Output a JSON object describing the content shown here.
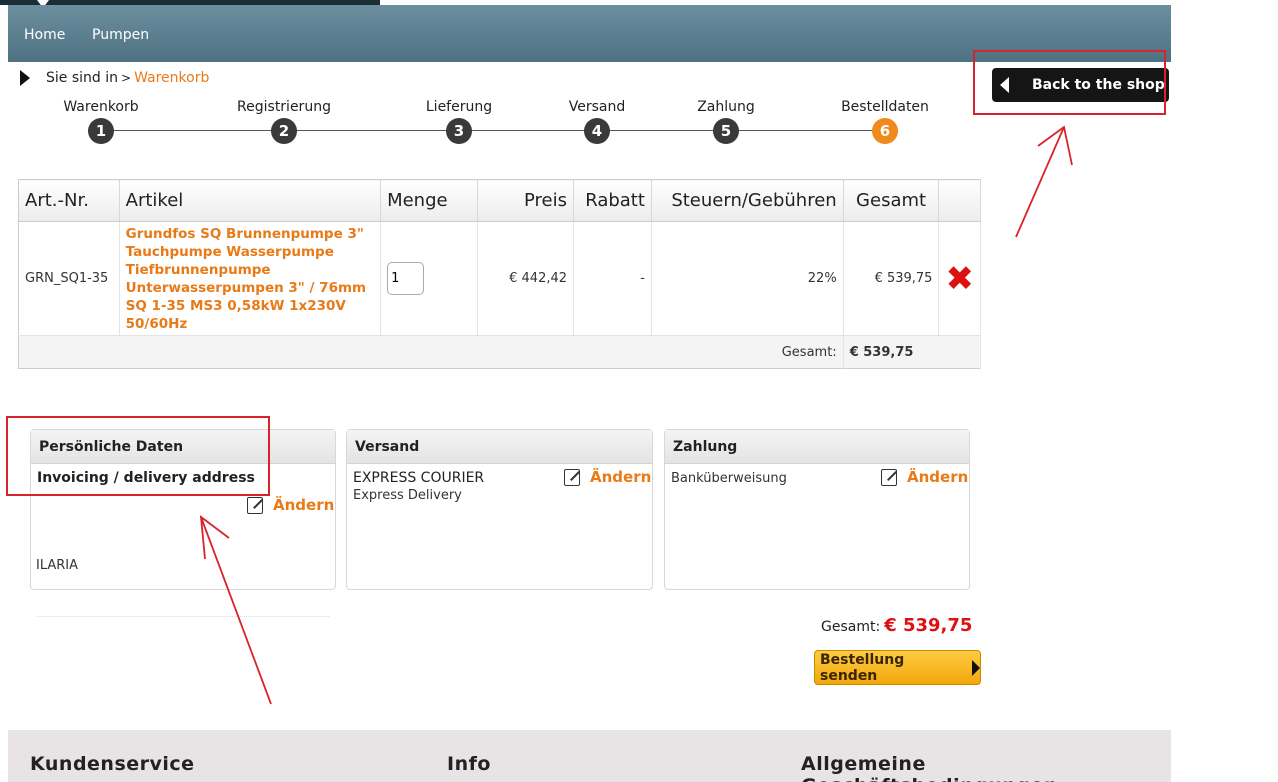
{
  "nav": {
    "items": [
      "Home",
      "Pumpen"
    ]
  },
  "breadcrumb": {
    "prefix": "Sie sind in",
    "separator": ">",
    "current": "Warenkorb"
  },
  "back_button": {
    "label": "Back to the shop"
  },
  "steps": [
    {
      "label": "Warenkorb",
      "number": "1"
    },
    {
      "label": "Registrierung",
      "number": "2"
    },
    {
      "label": "Lieferung",
      "number": "3"
    },
    {
      "label": "Versand",
      "number": "4"
    },
    {
      "label": "Zahlung",
      "number": "5"
    },
    {
      "label": "Bestelldaten",
      "number": "6",
      "active": true
    }
  ],
  "cart": {
    "headers": [
      "Art.-Nr.",
      "Artikel",
      "Menge",
      "Preis",
      "Rabatt",
      "Steuern/Gebühren",
      "Gesamt"
    ],
    "item": {
      "art_nr": "GRN_SQ1-35",
      "name": "Grundfos SQ Brunnenpumpe 3\" Tauchpumpe Wasserpumpe Tiefbrunnenpumpe Unterwasserpumpen 3\" / 76mm SQ 1-35 MS3 0,58kW 1x230V 50/60Hz",
      "quantity": "1",
      "price": "€ 442,42",
      "discount": "-",
      "tax": "22%",
      "total": "€ 539,75"
    },
    "total_label": "Gesamt:",
    "total_value": "€ 539,75"
  },
  "panels": {
    "personal": {
      "title": "Persönliche Daten",
      "subtitle": "Invoicing / delivery address",
      "edit": "Ändern",
      "name": "ILARIA"
    },
    "shipping": {
      "title": "Versand",
      "method": "EXPRESS COURIER",
      "detail": "Express Delivery",
      "edit": "Ändern"
    },
    "payment": {
      "title": "Zahlung",
      "method": "Banküberweisung",
      "edit": "Ändern"
    }
  },
  "summary": {
    "label": "Gesamt:",
    "value": "€ 539,75"
  },
  "submit_button": {
    "label": "Bestellung senden"
  },
  "footer": {
    "items": [
      "Kundenservice",
      "Info",
      "Allgemeine Geschäftsbedingungen"
    ]
  },
  "colors": {
    "accent": "#e87a17",
    "price_red": "#dd1111",
    "nav_bg": "#5a7e8e",
    "annotation_red": "#d9232a"
  }
}
